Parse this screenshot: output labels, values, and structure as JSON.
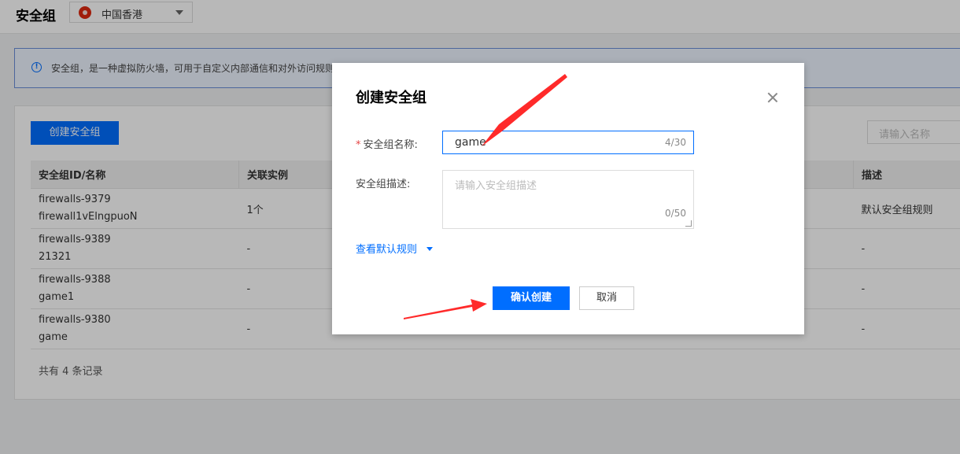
{
  "header": {
    "title": "安全组",
    "region": "中国香港"
  },
  "notice": {
    "text": "安全组，是一种虚拟防火墙，可用于自定义内部通信和对外访问规则"
  },
  "toolbar": {
    "create_label": "创建安全组",
    "search_placeholder": "请输入名称"
  },
  "table": {
    "columns": [
      "安全组ID/名称",
      "关联实例",
      "描述"
    ],
    "rows": [
      {
        "id": "firewalls-9379",
        "name": "firewall1vElngpuoN",
        "instances": "1个",
        "desc": "默认安全组规则"
      },
      {
        "id": "firewalls-9389",
        "name": "21321",
        "instances": "-",
        "desc": "-"
      },
      {
        "id": "firewalls-9388",
        "name": "game1",
        "instances": "-",
        "desc": "-"
      },
      {
        "id": "firewalls-9380",
        "name": "game",
        "instances": "-",
        "desc": "-"
      }
    ],
    "total_text": "共有 4 条记录"
  },
  "dialog": {
    "title": "创建安全组",
    "name_label": "安全组名称:",
    "name_required_mark": "*",
    "name_value": "game",
    "name_counter": "4/30",
    "desc_label": "安全组描述:",
    "desc_placeholder": "请输入安全组描述",
    "desc_counter": "0/50",
    "rules_link": "查看默认规则",
    "confirm_label": "确认创建",
    "cancel_label": "取消"
  },
  "annotation_color": "#ff2a2a"
}
